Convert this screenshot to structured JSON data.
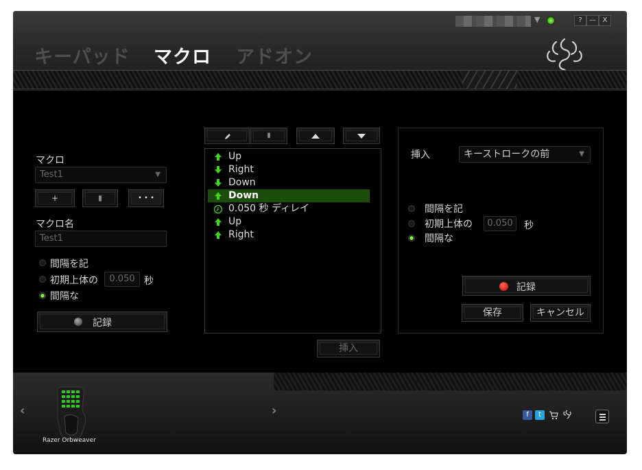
{
  "window": {
    "tabs": [
      {
        "label": "キーパッド",
        "active": false
      },
      {
        "label": "マクロ",
        "active": true
      },
      {
        "label": "アドオン",
        "active": false
      }
    ],
    "controls": {
      "help": "?",
      "minimize": "—",
      "close": "X"
    },
    "status_color": "#44cc22"
  },
  "left": {
    "macro_label": "マクロ",
    "macro_select": "Test1",
    "add_btn": "+",
    "delete_btn_icon": "trash-icon",
    "more_btn": "• • •",
    "name_label": "マクロ名",
    "name_value": "Test1",
    "radio": [
      {
        "label": "間隔を記",
        "on": false
      },
      {
        "label": "初期上体の",
        "on": false
      },
      {
        "label": "間隔な",
        "on": true
      }
    ],
    "delay_value": "0.050",
    "delay_unit": "秒",
    "record_label": "記録"
  },
  "center": {
    "toolbar_icons": [
      "pencil-icon",
      "trash-icon",
      "arrow-up-icon",
      "arrow-down-icon"
    ],
    "items": [
      {
        "icon": "up-arrow",
        "text": "Up",
        "selected": false
      },
      {
        "icon": "down-arrow",
        "text": "Right",
        "selected": false
      },
      {
        "icon": "down-arrow",
        "text": "Down",
        "selected": false
      },
      {
        "icon": "up-arrow",
        "text": "Down",
        "selected": true
      },
      {
        "icon": "clock",
        "text": "0.050 秒 ディレイ",
        "selected": false
      },
      {
        "icon": "up-arrow",
        "text": "Up",
        "selected": false
      },
      {
        "icon": "up-arrow",
        "text": "Right",
        "selected": false
      }
    ],
    "insert_btn": "挿入"
  },
  "right": {
    "insert_label": "挿入",
    "insert_select": "キーストロークの前",
    "radio": [
      {
        "label": "間隔を記",
        "on": false
      },
      {
        "label": "初期上体の",
        "on": false
      },
      {
        "label": "間隔な",
        "on": true
      }
    ],
    "delay_value": "0.050",
    "delay_unit": "秒",
    "record_label": "記録",
    "save_label": "保存",
    "cancel_label": "キャンセル"
  },
  "footer": {
    "device_name": "Razer Orbweaver",
    "prev": "‹",
    "next": "›",
    "social": [
      "facebook-icon",
      "twitter-icon",
      "cart-icon",
      "razer-icon"
    ],
    "menu_icon": "menu-icon"
  },
  "colors": {
    "accent_green": "#44cc22",
    "record_red": "#e02020",
    "selected_row": "#1d4d0a"
  }
}
